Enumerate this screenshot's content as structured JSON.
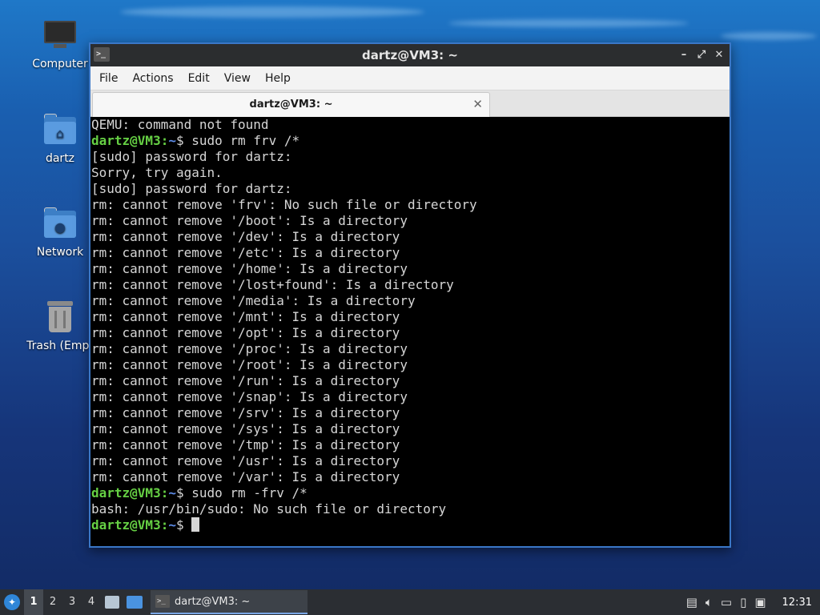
{
  "desktop": {
    "icons": [
      {
        "label": "Computer"
      },
      {
        "label": "dartz"
      },
      {
        "label": "Network"
      },
      {
        "label": "Trash (Empt"
      }
    ]
  },
  "window": {
    "title": "dartz@VM3: ~",
    "app_icon_text": ">_",
    "controls": {
      "minimize": "–",
      "maximize": "⤢",
      "close": "✕"
    }
  },
  "menu": [
    "File",
    "Actions",
    "Edit",
    "View",
    "Help"
  ],
  "tab": {
    "label": "dartz@VM3: ~",
    "close": "✕"
  },
  "terminal": {
    "prompt_user": "dartz@VM3",
    "prompt_path": "~",
    "lines": [
      {
        "type": "out",
        "text": "QEMU: command not found"
      },
      {
        "type": "cmd",
        "text": "$ sudo rm frv /*"
      },
      {
        "type": "out",
        "text": "[sudo] password for dartz:"
      },
      {
        "type": "out",
        "text": "Sorry, try again."
      },
      {
        "type": "out",
        "text": "[sudo] password for dartz:"
      },
      {
        "type": "out",
        "text": "rm: cannot remove 'frv': No such file or directory"
      },
      {
        "type": "out",
        "text": "rm: cannot remove '/boot': Is a directory"
      },
      {
        "type": "out",
        "text": "rm: cannot remove '/dev': Is a directory"
      },
      {
        "type": "out",
        "text": "rm: cannot remove '/etc': Is a directory"
      },
      {
        "type": "out",
        "text": "rm: cannot remove '/home': Is a directory"
      },
      {
        "type": "out",
        "text": "rm: cannot remove '/lost+found': Is a directory"
      },
      {
        "type": "out",
        "text": "rm: cannot remove '/media': Is a directory"
      },
      {
        "type": "out",
        "text": "rm: cannot remove '/mnt': Is a directory"
      },
      {
        "type": "out",
        "text": "rm: cannot remove '/opt': Is a directory"
      },
      {
        "type": "out",
        "text": "rm: cannot remove '/proc': Is a directory"
      },
      {
        "type": "out",
        "text": "rm: cannot remove '/root': Is a directory"
      },
      {
        "type": "out",
        "text": "rm: cannot remove '/run': Is a directory"
      },
      {
        "type": "out",
        "text": "rm: cannot remove '/snap': Is a directory"
      },
      {
        "type": "out",
        "text": "rm: cannot remove '/srv': Is a directory"
      },
      {
        "type": "out",
        "text": "rm: cannot remove '/sys': Is a directory"
      },
      {
        "type": "out",
        "text": "rm: cannot remove '/tmp': Is a directory"
      },
      {
        "type": "out",
        "text": "rm: cannot remove '/usr': Is a directory"
      },
      {
        "type": "out",
        "text": "rm: cannot remove '/var': Is a directory"
      },
      {
        "type": "cmd",
        "text": "$ sudo rm -frv /*"
      },
      {
        "type": "out",
        "text": "bash: /usr/bin/sudo: No such file or directory"
      },
      {
        "type": "cmd",
        "text": "$ ",
        "cursor": true
      }
    ]
  },
  "taskbar": {
    "workspaces": [
      "1",
      "2",
      "3",
      "4"
    ],
    "active_workspace": "1",
    "task_label": "dartz@VM3: ~",
    "task_icon_text": ">_",
    "clock": "12:31"
  },
  "colors": {
    "prompt_green": "#66d044",
    "path_blue": "#5d8ce8",
    "window_border": "#3a77c7"
  }
}
